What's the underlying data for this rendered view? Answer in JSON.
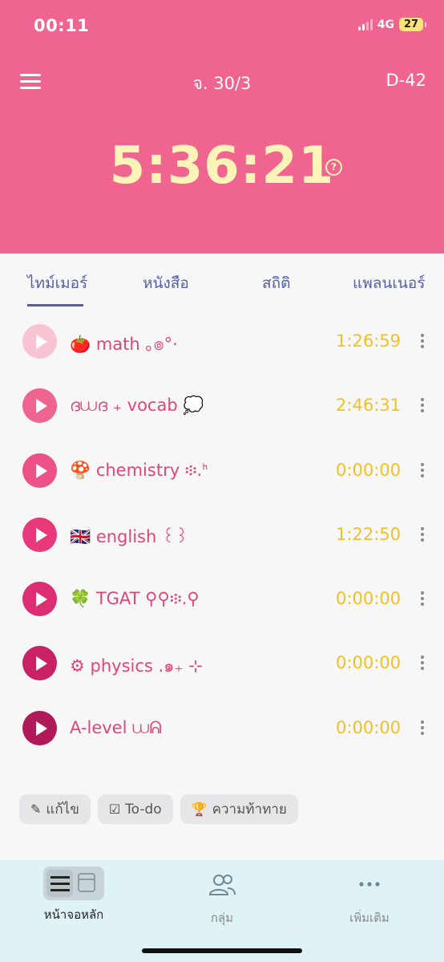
{
  "status_bar": {
    "time": "00:11",
    "network": "4G",
    "battery": "27"
  },
  "header": {
    "date": "จ. 30/3",
    "dday": "D-42",
    "timer": "5:36:21",
    "help_icon": "question-circle-icon"
  },
  "tabs": [
    {
      "label": "ไทม์เมอร์",
      "active": true
    },
    {
      "label": "หนังสือ"
    },
    {
      "label": "สถิติ"
    },
    {
      "label": "แพลนเนอร์"
    }
  ],
  "subjects": [
    {
      "name": "🍅 math ｡๏°·",
      "time": "1:26:59",
      "color": "#f8c4d4"
    },
    {
      "name": "ദ⩊ദ ₊ vocab 💭",
      "time": "2:46:31",
      "color": "#f06490"
    },
    {
      "name": "🍄 chemistry ፨.ᑋ",
      "time": "0:00:00",
      "color": "#ec5288"
    },
    {
      "name": "🇬🇧 english ꒰꒱",
      "time": "1:22:50",
      "color": "#e83a7a"
    },
    {
      "name": "🍀 TGAT ⚲⚲፨.⚲",
      "time": "0:00:00",
      "color": "#dc2e70"
    },
    {
      "name": "⚙ physics .๑₊ ⊹",
      "time": "0:00:00",
      "color": "#c92264"
    },
    {
      "name": "A-level ⩊ᕱ",
      "time": "0:00:00",
      "color": "#b11a58"
    }
  ],
  "actions": {
    "edit": "แก้ไข",
    "todo": "To-do",
    "challenge": "ความท้าทาย"
  },
  "bottom_nav": {
    "home": "หน้าจอหลัก",
    "group": "กลุ่ม",
    "more": "เพิ่มเติม"
  }
}
